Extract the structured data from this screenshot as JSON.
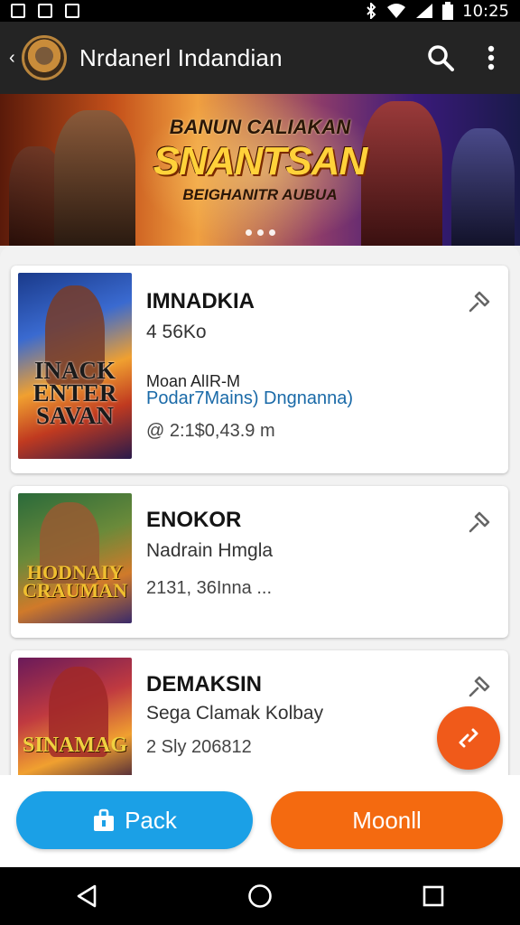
{
  "status_bar": {
    "time": "10:25"
  },
  "app_bar": {
    "title": "Nrdanerl Indandian"
  },
  "banner": {
    "line1": "BANUN CALIAKAN",
    "line2": "SNANTSAN",
    "line3": "BEIGHANITR AUBUA"
  },
  "items": [
    {
      "title": "IMNADKIA",
      "line1": "4 56Ko",
      "line2": "Moan AlIR-M",
      "line3": "Podar7Mains) Dngnanna)",
      "line4": "@ 2:1$0,43.9 m",
      "thumb_text": "INACK ENTER SAVAN"
    },
    {
      "title": "ENOKOR",
      "line1": "Nadrain Hmgla",
      "line2": "2131, 36Inna ...",
      "thumb_text": "HODNAIY CRAUMAN"
    },
    {
      "title": "DEMAKSIN",
      "line1": "Sega Clamak  Kolbay",
      "line2": "2 Sly 206812",
      "thumb_text": "SINAMAG"
    }
  ],
  "buttons": {
    "pack": "Pack",
    "moon": "Moonll"
  },
  "colors": {
    "app_bar": "#242424",
    "pack_button": "#1ba0e6",
    "moon_button": "#f46a10",
    "fab": "#f05a1a"
  },
  "icons": [
    "back-arrow-icon",
    "search-icon",
    "more-vert-icon",
    "pin-icon",
    "swap-icon",
    "bag-icon",
    "nav-back-icon",
    "nav-home-icon",
    "nav-recents-icon"
  ]
}
